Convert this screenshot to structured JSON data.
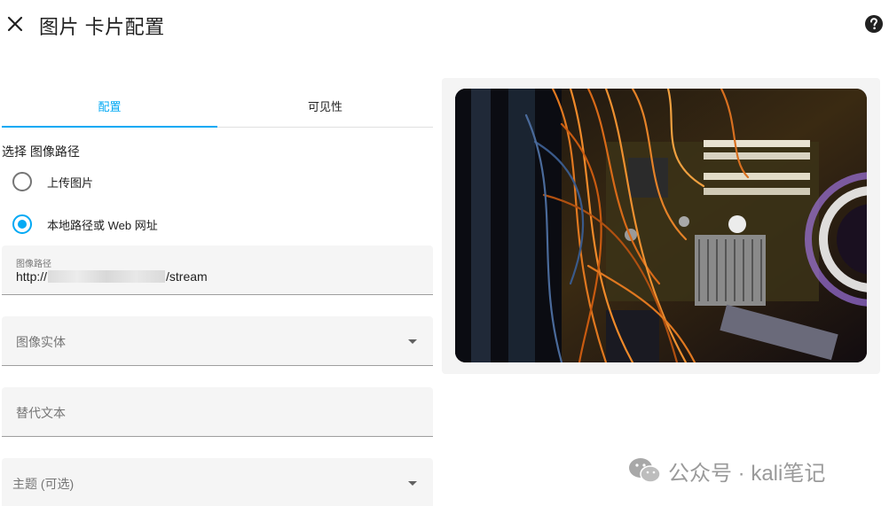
{
  "header": {
    "title": "图片 卡片配置",
    "close_icon": "close-icon",
    "help_icon": "help-circle-icon"
  },
  "tabs": [
    {
      "label": "配置",
      "active": true
    },
    {
      "label": "可见性",
      "active": false
    }
  ],
  "image_source": {
    "label": "选择 图像路径",
    "options": [
      {
        "label": "上传图片",
        "checked": false
      },
      {
        "label": "本地路径或 Web 网址",
        "checked": true
      }
    ]
  },
  "fields": {
    "image_path": {
      "label": "图像路径",
      "value_prefix": "http://",
      "value_suffix": "/stream"
    },
    "image_entity": {
      "label": "图像实体"
    },
    "alt_text": {
      "label": "替代文本"
    },
    "theme": {
      "label": "主题 (可选)"
    }
  },
  "watermark": {
    "text": "公众号 · kali笔记"
  },
  "colors": {
    "accent": "#03a9f4",
    "field_bg": "#f5f5f5",
    "text": "#212121",
    "secondary_text": "#757575"
  }
}
